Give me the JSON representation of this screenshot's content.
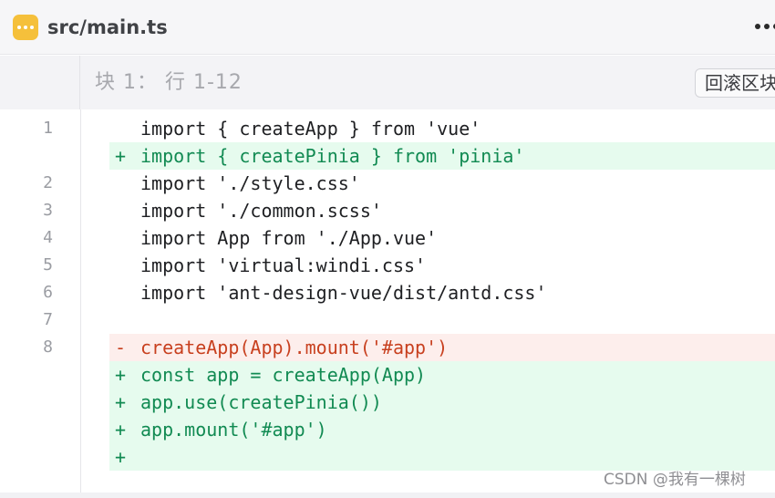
{
  "header": {
    "file_name": "src/main.ts",
    "icon": "file-more-icon",
    "more_icon": "more-horizontal-icon",
    "colors": {
      "icon_bg": "#f5c03b"
    }
  },
  "hunk": {
    "title": "块 1： 行 1-12",
    "rollback_label": "回滚区块"
  },
  "lines": [
    {
      "num": "1",
      "marker": "",
      "type": "context",
      "code": "import { createApp } from 'vue'"
    },
    {
      "num": "",
      "marker": "+",
      "type": "added",
      "code": "import { createPinia } from 'pinia'"
    },
    {
      "num": "2",
      "marker": "",
      "type": "context",
      "code": "import './style.css'"
    },
    {
      "num": "3",
      "marker": "",
      "type": "context",
      "code": "import './common.scss'"
    },
    {
      "num": "4",
      "marker": "",
      "type": "context",
      "code": "import App from './App.vue'"
    },
    {
      "num": "5",
      "marker": "",
      "type": "context",
      "code": "import 'virtual:windi.css'"
    },
    {
      "num": "6",
      "marker": "",
      "type": "context",
      "code": "import 'ant-design-vue/dist/antd.css'"
    },
    {
      "num": "7",
      "marker": "",
      "type": "context",
      "code": ""
    },
    {
      "num": "8",
      "marker": "-",
      "type": "removed",
      "code": "createApp(App).mount('#app')"
    },
    {
      "num": "",
      "marker": "+",
      "type": "added",
      "code": "const app = createApp(App)"
    },
    {
      "num": "",
      "marker": "+",
      "type": "added",
      "code": "app.use(createPinia())"
    },
    {
      "num": "",
      "marker": "+",
      "type": "added",
      "code": "app.mount('#app')"
    },
    {
      "num": "",
      "marker": "+",
      "type": "added",
      "code": ""
    }
  ],
  "colors": {
    "added_bg": "#e6fbee",
    "added_text": "#118a52",
    "removed_bg": "#fdeeec",
    "removed_text": "#c8401f"
  },
  "watermark": "CSDN @我有一棵树"
}
